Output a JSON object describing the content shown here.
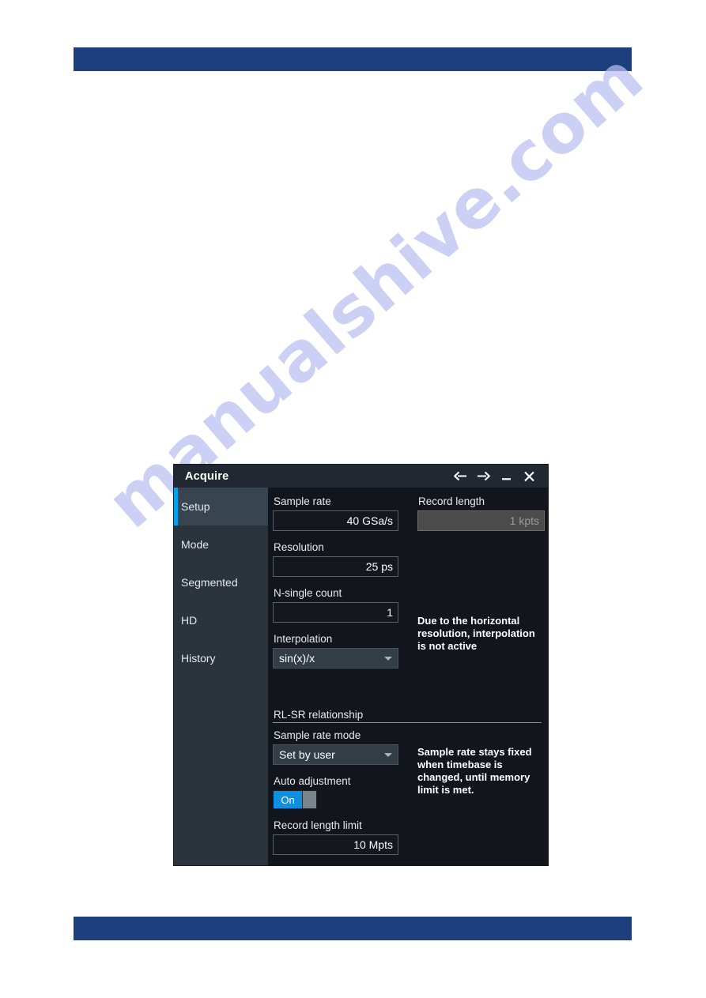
{
  "watermark": {
    "text": "manualshive.com"
  },
  "dialog": {
    "title": "Acquire",
    "titlebar_buttons": [
      {
        "name": "back-button",
        "icon": "arrow-left-icon",
        "label": "Back"
      },
      {
        "name": "forward-button",
        "icon": "arrow-right-icon",
        "label": "Forward"
      },
      {
        "name": "minimize-button",
        "icon": "minimize-icon",
        "label": "Minimize"
      },
      {
        "name": "close-button",
        "icon": "close-icon",
        "label": "Close"
      }
    ],
    "sidebar": {
      "items": [
        {
          "label": "Setup",
          "selected": true
        },
        {
          "label": "Mode",
          "selected": false
        },
        {
          "label": "Segmented",
          "selected": false
        },
        {
          "label": "HD",
          "selected": false
        },
        {
          "label": "History",
          "selected": false
        }
      ]
    },
    "setup": {
      "sample_rate": {
        "label": "Sample rate",
        "value": "40 GSa/s"
      },
      "record_length": {
        "label": "Record length",
        "value": "1 kpts",
        "disabled": true
      },
      "resolution": {
        "label": "Resolution",
        "value": "25 ps"
      },
      "n_single_count": {
        "label": "N-single count",
        "value": "1"
      },
      "interpolation": {
        "label": "Interpolation",
        "value": "sin(x)/x",
        "info": "Due to the horizontal resolution, interpolation is not active"
      },
      "rl_sr_section": {
        "title": "RL-SR relationship"
      },
      "sample_rate_mode": {
        "label": "Sample rate mode",
        "value": "Set by user",
        "info": "Sample rate stays fixed when timebase is changed, until memory limit is met."
      },
      "auto_adjustment": {
        "label": "Auto adjustment",
        "value": "On"
      },
      "record_length_limit": {
        "label": "Record length limit",
        "value": "10 Mpts"
      }
    }
  },
  "colors": {
    "page_bar": "#1d3f7e",
    "accent": "#00a2e8",
    "toggle_on": "#0f8fe0",
    "dialog_bg": "#12161c",
    "sidebar_bg": "#2b343d",
    "titlebar_bg": "#222831",
    "watermark": "#b9bff0"
  }
}
